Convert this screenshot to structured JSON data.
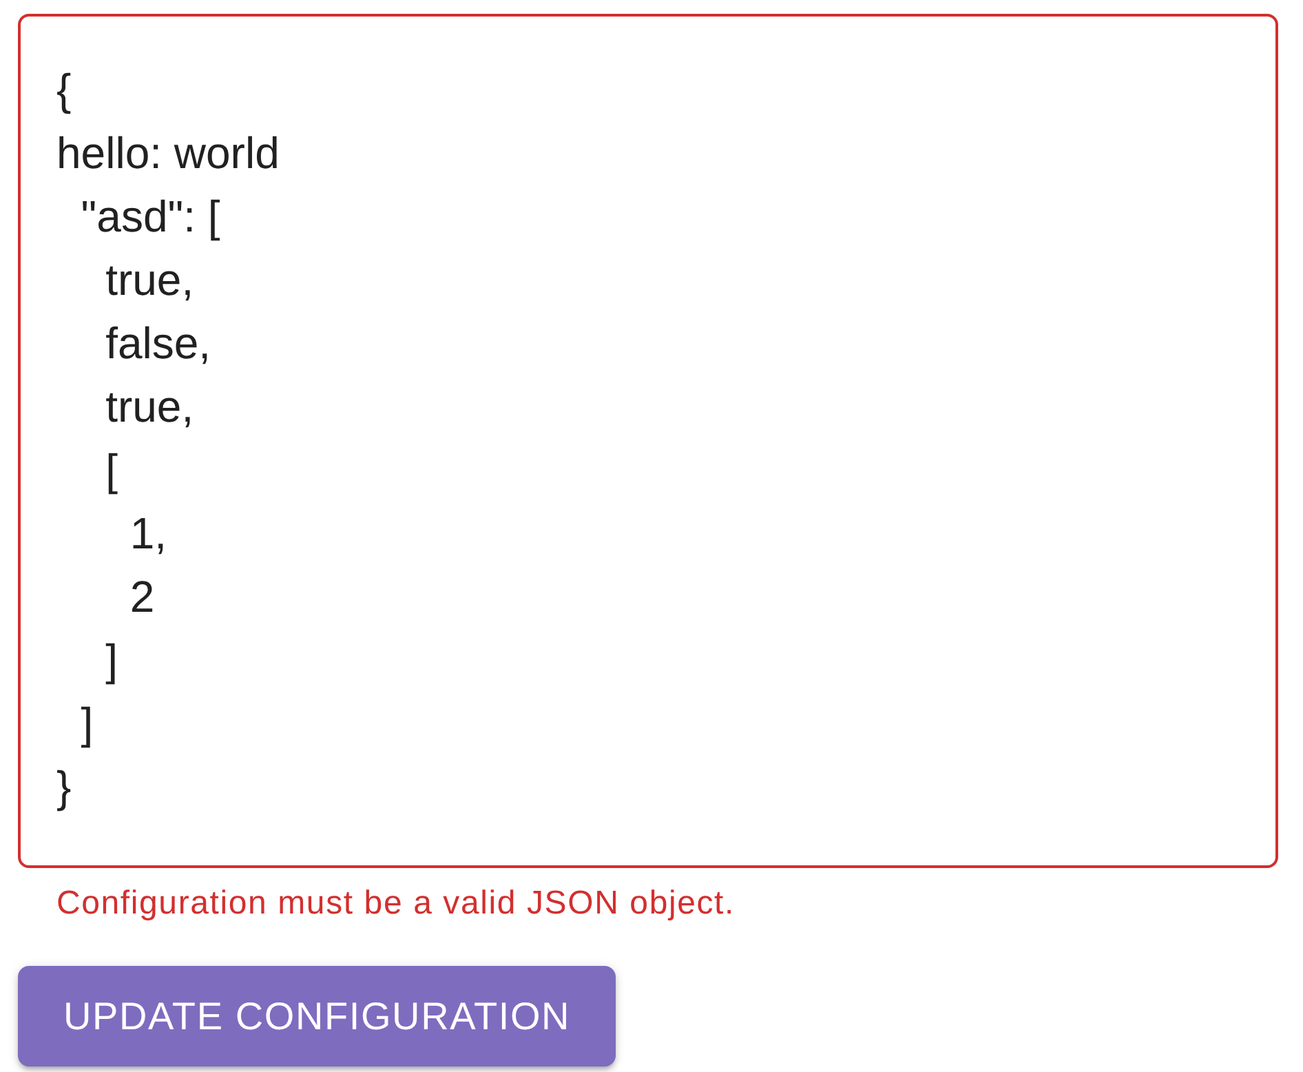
{
  "config_field": {
    "value": "{\nhello: world\n  \"asd\": [\n    true,\n    false,\n    true,\n    [\n      1,\n      2\n    ]\n  ]\n}",
    "error": true
  },
  "helper_text": "Configuration must be a valid JSON object.",
  "button": {
    "label": "UPDATE CONFIGURATION"
  }
}
